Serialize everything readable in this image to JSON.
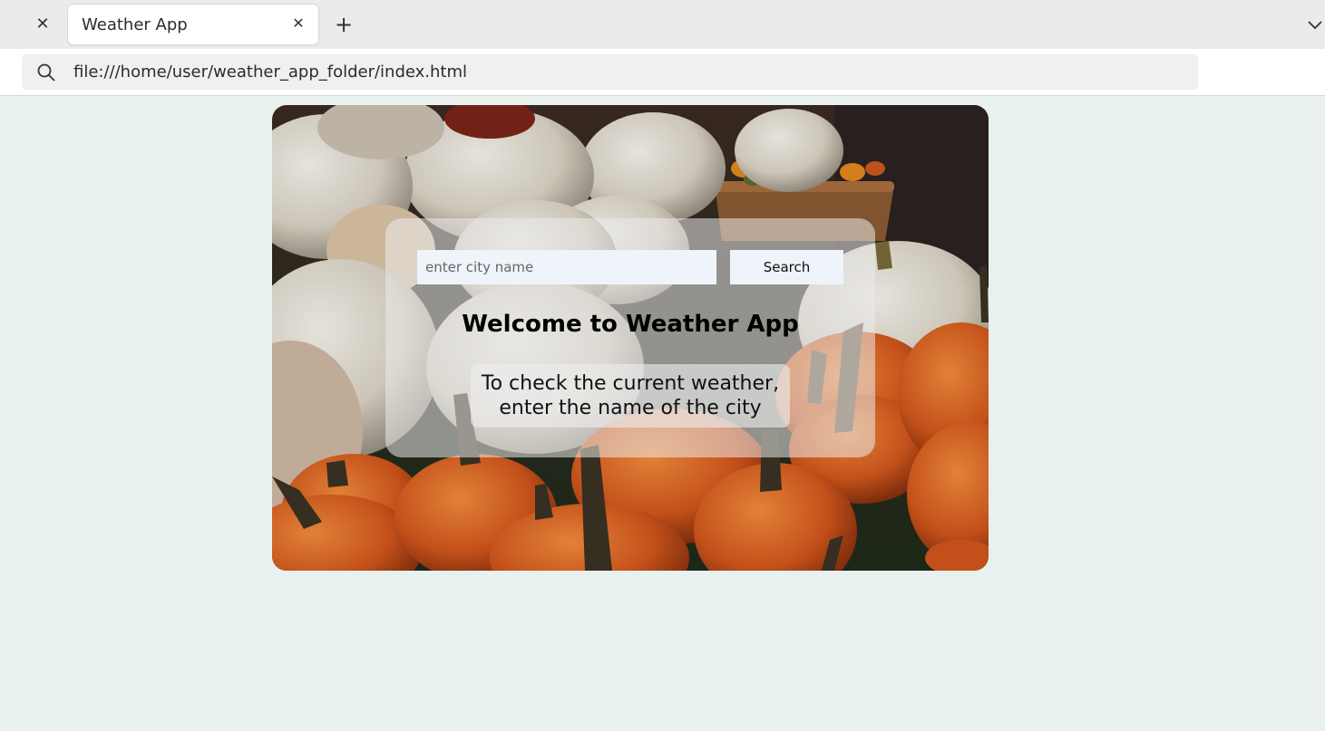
{
  "browser": {
    "tab_title": "Weather App",
    "address": "file:///home/user/weather_app_folder/index.html",
    "icons": {
      "close_prev": "close-icon",
      "tab_close": "close-icon",
      "new_tab": "plus-icon",
      "tab_list": "chevron-down-icon",
      "url_search": "search-icon"
    },
    "glyphs": {
      "close": "✕",
      "plus": "+"
    }
  },
  "app": {
    "search": {
      "placeholder": "enter city name",
      "value": "",
      "button_label": "Search"
    },
    "heading": "Welcome to Weather App",
    "instruction_line1": "To check the current weather,",
    "instruction_line2": "enter the name of the city"
  },
  "colors": {
    "page_background": "#e9f1ee",
    "input_background": "#eef4fa",
    "panel_overlay": "rgba(235,235,235,0.55)"
  }
}
